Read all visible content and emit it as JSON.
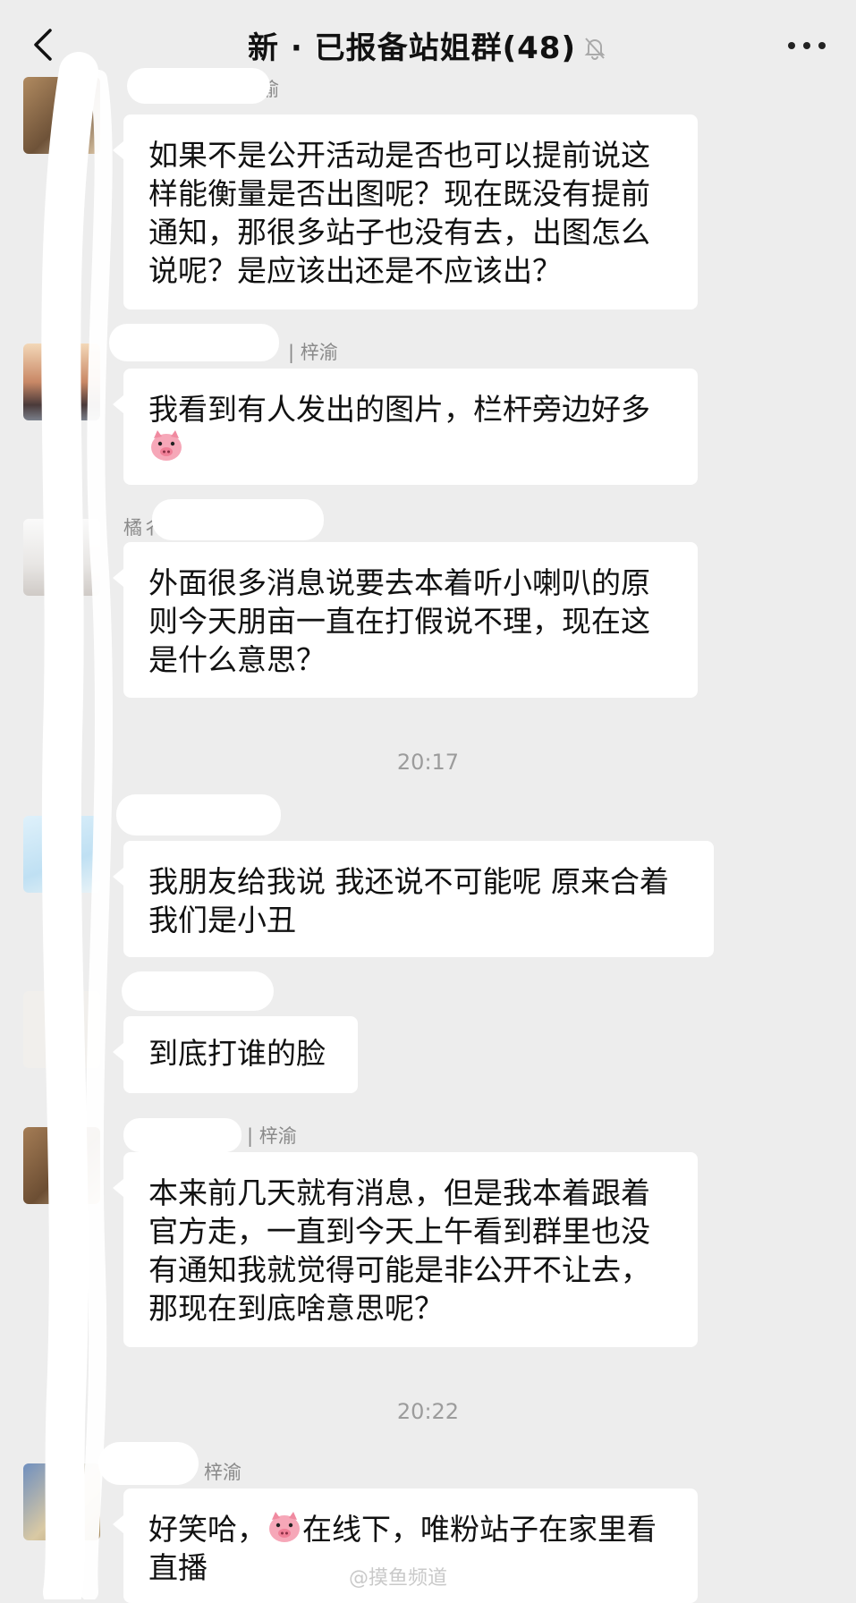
{
  "header": {
    "title": "新 · 已报备站姐群(48)",
    "back_icon": "chevron-left-icon",
    "mute_icon": "bell-off-icon",
    "more_icon": "more-dots-icon"
  },
  "messages": [
    {
      "sender": "梓渝",
      "lines": [
        "如果不是公开活动是否也可以提前说这",
        "样能衡量是否出图呢？现在既没有提前",
        "通知，那很多站子也没有去，出图怎么",
        "说呢？是应该出还是不应该出？"
      ]
    },
    {
      "sender": "| 梓渝",
      "lines": [
        "我看到有人发出的图片，栏杆旁边好多"
      ],
      "emoji": "pig-face"
    },
    {
      "sender": "橘彳",
      "lines": [
        "外面很多消息说要去本着听小喇叭的原",
        "则今天朋亩一直在打假说不理，现在这",
        "是什么意思？"
      ]
    },
    {
      "sender": "",
      "lines": [
        "我朋友给我说 我还说不可能呢 原来合着",
        "我们是小丑"
      ]
    },
    {
      "sender": "",
      "lines": [
        "到底打谁的脸"
      ]
    },
    {
      "sender": "| 梓渝",
      "lines": [
        "本来前几天就有消息，但是我本着跟着",
        "官方走，一直到今天上午看到群里也没",
        "有通知我就觉得可能是非公开不让去，",
        "那现在到底啥意思呢？"
      ]
    },
    {
      "sender": "梓渝",
      "line_pre": "好笑哈，",
      "line_post": "在线下，唯粉站子在家里看",
      "line2": "直播"
    }
  ],
  "timestamps": [
    "20:17",
    "20:22"
  ],
  "watermark": "@摸鱼频道",
  "colors": {
    "background": "#ededed",
    "bubble": "#ffffff",
    "meta_text": "#8a8a8a"
  }
}
